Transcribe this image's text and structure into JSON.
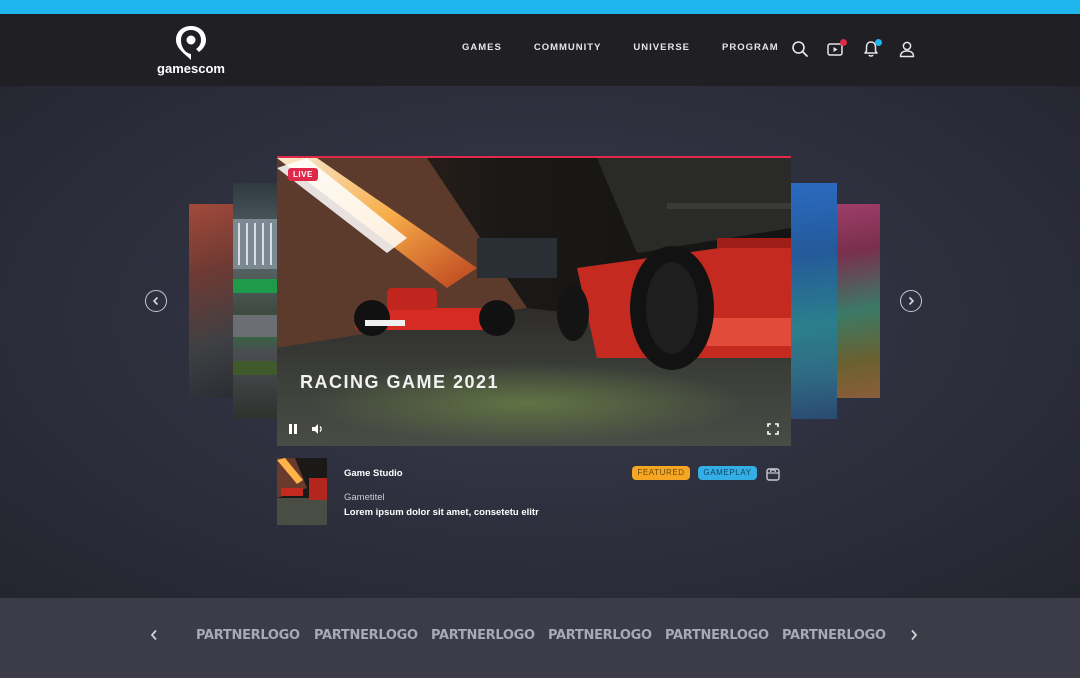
{
  "brand": {
    "name": "gamescom"
  },
  "nav": {
    "items": [
      "GAMES",
      "COMMUNITY",
      "UNIVERSE",
      "PROGRAM"
    ]
  },
  "header_icons": [
    "search-icon",
    "video-icon",
    "bell-icon",
    "user-icon"
  ],
  "colors": {
    "accent_red": "#e0284a",
    "accent_blue": "#1fb6ee",
    "featured": "#f6a623",
    "gameplay": "#34aee6"
  },
  "hero": {
    "live_label": "LIVE",
    "title": "RACING GAME 2021"
  },
  "info": {
    "studio": "Game Studio",
    "game_title": "Gametitel",
    "description": "Lorem ipsum dolor sit amet, consetetu elitr",
    "tags": [
      "FEATURED",
      "GAMEPLAY"
    ]
  },
  "partners": {
    "logos": [
      "PARTNERLOGO",
      "PARTNERLOGO",
      "PARTNERLOGO",
      "PARTNERLOGO",
      "PARTNERLOGO",
      "PARTNERLOGO"
    ]
  }
}
